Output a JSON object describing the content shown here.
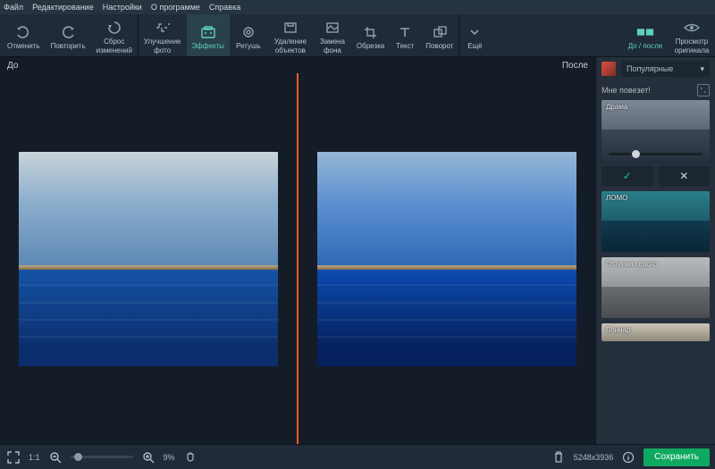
{
  "menu": {
    "file": "Файл",
    "edit": "Редактирование",
    "settings": "Настройки",
    "about": "О программе",
    "help": "Справка"
  },
  "toolbar": {
    "undo": "Отменить",
    "redo": "Повторить",
    "reset": "Сброс",
    "reset2": "изменений",
    "enhance": "Улучшение",
    "enhance2": "фото",
    "effects": "Эффекты",
    "retouch": "Ретушь",
    "removeobj": "Удаление",
    "removeobj2": "объектов",
    "bg": "Замена",
    "bg2": "фона",
    "crop": "Обрезка",
    "text": "Текст",
    "rotate": "Поворот",
    "more": "Ещё",
    "beforeafter": "До / после",
    "vieworig": "Просмотр",
    "vieworig2": "оригинала"
  },
  "canvas": {
    "before": "До",
    "after": "После"
  },
  "right": {
    "popular": "Популярные",
    "lucky": "Мне повезет!",
    "fx": {
      "drama": "Драма",
      "lomo": "ЛОМО",
      "grey": "Оттенки серого",
      "bonnard": "Боннар"
    }
  },
  "bottom": {
    "fit": "1:1",
    "zoom": "9%",
    "dims": "5248x3936",
    "save": "Сохранить"
  }
}
